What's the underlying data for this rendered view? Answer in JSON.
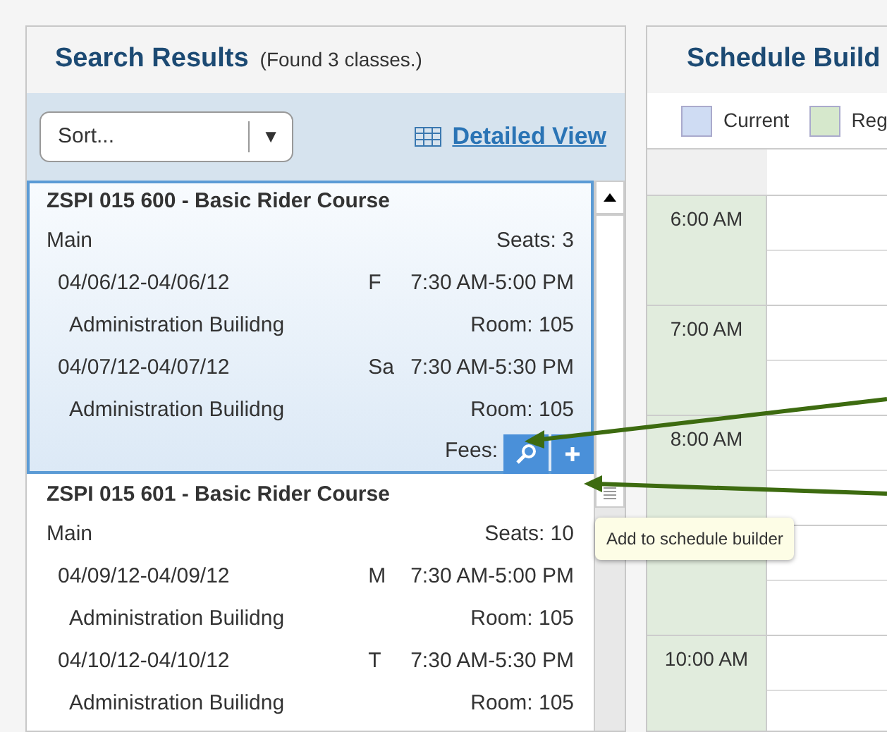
{
  "search_panel": {
    "title": "Search Results",
    "count": "(Found 3 classes.)",
    "sort": {
      "value": "Sort...",
      "caret": "▼"
    },
    "detailed_view_link": "Detailed View"
  },
  "results": [
    {
      "title": "ZSPI 015 600 - Basic Rider Course",
      "campus": "Main",
      "seats": "Seats: 3",
      "selected": true,
      "fees": "Fees:",
      "meetings": [
        {
          "dates": "04/06/12-04/06/12",
          "day": "F",
          "time": "7:30 AM-5:00 PM",
          "building": "Administration Builidng",
          "room": "Room: 105"
        },
        {
          "dates": "04/07/12-04/07/12",
          "day": "Sa",
          "time": "7:30 AM-5:30 PM",
          "building": "Administration Builidng",
          "room": "Room: 105"
        }
      ]
    },
    {
      "title": "ZSPI 015 601 - Basic Rider Course",
      "campus": "Main",
      "seats": "Seats: 10",
      "selected": false,
      "meetings": [
        {
          "dates": "04/09/12-04/09/12",
          "day": "M",
          "time": "7:30 AM-5:00 PM",
          "building": "Administration Builidng",
          "room": "Room: 105"
        },
        {
          "dates": "04/10/12-04/10/12",
          "day": "T",
          "time": "7:30 AM-5:30 PM",
          "building": "Administration Builidng",
          "room": "Room: 105"
        }
      ]
    }
  ],
  "tooltip": "Add to schedule builder",
  "schedule_panel": {
    "title": "Schedule Build",
    "legend": [
      {
        "label": "Current",
        "color": "#cfdcf3"
      },
      {
        "label": "Reg",
        "color": "#d6e8cc"
      }
    ],
    "rows": [
      {
        "kind": "hour",
        "time": "6:00 AM"
      },
      {
        "kind": "hour",
        "time": "7:00 AM"
      },
      {
        "kind": "hour",
        "time": "8:00 AM"
      },
      {
        "kind": "blank"
      },
      {
        "kind": "hour",
        "time": "10:00 AM"
      }
    ]
  }
}
